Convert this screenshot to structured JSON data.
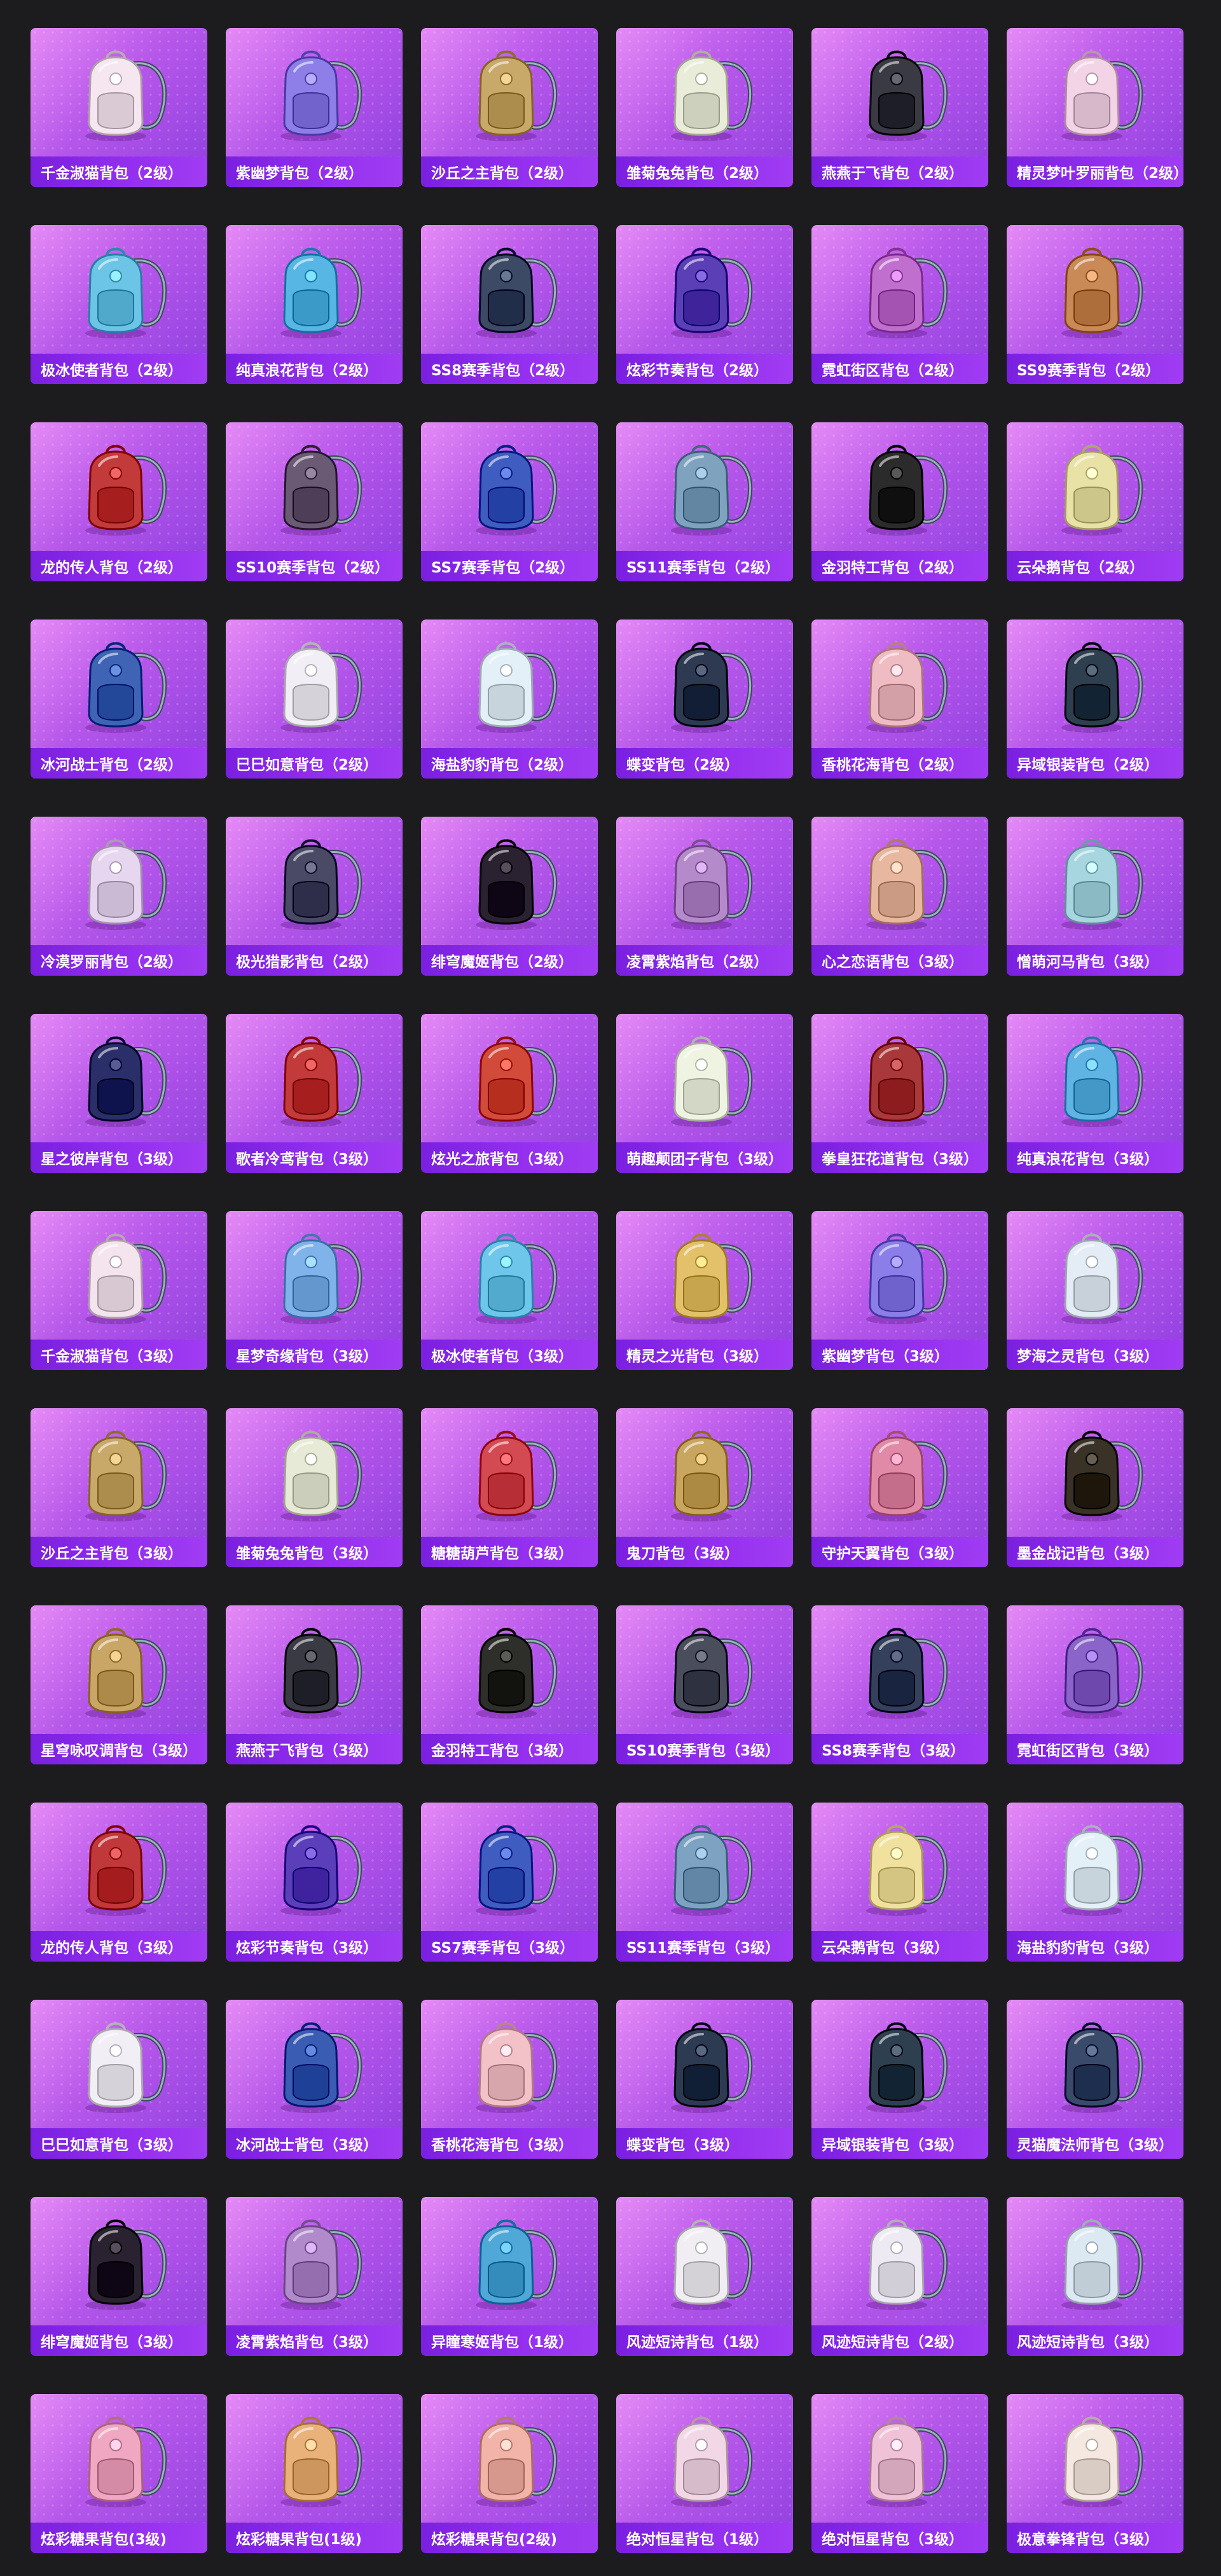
{
  "items": [
    {
      "name": "千金淑猫背包（2级）",
      "icon": "cat-backpack-icon",
      "color": "#f5e6ef"
    },
    {
      "name": "紫幽梦背包（2级）",
      "icon": "purple-bunny-backpack-icon",
      "color": "#8d7ee8"
    },
    {
      "name": "沙丘之主背包（2级）",
      "icon": "scroll-backpack-icon",
      "color": "#c9a96a"
    },
    {
      "name": "雏菊兔兔背包（2级）",
      "icon": "daisy-bunny-backpack-icon",
      "color": "#e9ecd8"
    },
    {
      "name": "燕燕于飞背包（2级）",
      "icon": "swallow-backpack-icon",
      "color": "#3a3a44"
    },
    {
      "name": "精灵梦叶罗丽背包（2级）",
      "icon": "fairy-heart-backpack-icon",
      "color": "#f3d3e6"
    },
    {
      "name": "极冰使者背包（2级）",
      "icon": "ice-crystal-backpack-icon",
      "color": "#6cc4e6"
    },
    {
      "name": "纯真浪花背包（2级）",
      "icon": "drink-cup-backpack-icon",
      "color": "#57b6e4"
    },
    {
      "name": "SS8赛季背包（2级）",
      "icon": "tactical-backpack-icon",
      "color": "#3d4a66"
    },
    {
      "name": "炫彩节奏背包（2级）",
      "icon": "rhythm-backpack-icon",
      "color": "#5a3fb6"
    },
    {
      "name": "霓虹街区背包（2级）",
      "icon": "neon-backpack-icon",
      "color": "#c06fcf"
    },
    {
      "name": "SS9赛季背包（2级）",
      "icon": "orange-backpack-icon",
      "color": "#c98a57"
    },
    {
      "name": "龙的传人背包（2级）",
      "icon": "dragon-backpack-icon",
      "color": "#c33a3a"
    },
    {
      "name": "SS10赛季背包（2级）",
      "icon": "ss10-backpack-icon",
      "color": "#6b5a73"
    },
    {
      "name": "SS7赛季背包（2级）",
      "icon": "ss7-backpack-icon",
      "color": "#3f5cc0"
    },
    {
      "name": "SS11赛季背包（2级）",
      "icon": "ss11-backpack-icon",
      "color": "#7fa3bf"
    },
    {
      "name": "金羽特工背包（2级）",
      "icon": "agent-backpack-icon",
      "color": "#2b2b2b"
    },
    {
      "name": "云朵鹅背包（2级）",
      "icon": "cloud-goose-backpack-icon",
      "color": "#e9e2a6"
    },
    {
      "name": "冰河战士背包（2级）",
      "icon": "glacier-backpack-icon",
      "color": "#3f63b5"
    },
    {
      "name": "巳巳如意背包（2级）",
      "icon": "snake-backpack-icon",
      "color": "#f1eef5"
    },
    {
      "name": "海盐豹豹背包（2级）",
      "icon": "seal-backpack-icon",
      "color": "#e3f0f7"
    },
    {
      "name": "蝶变背包（2级）",
      "icon": "butterfly-backpack-icon",
      "color": "#2d3a52"
    },
    {
      "name": "香桃花海背包（2级）",
      "icon": "peach-backpack-icon",
      "color": "#f0bcc4"
    },
    {
      "name": "异域银装背包（2级）",
      "icon": "exotic-backpack-icon",
      "color": "#2e3f4f"
    },
    {
      "name": "冷漠罗丽背包（2级）",
      "icon": "crystal-heart-backpack-icon",
      "color": "#e7d6f0"
    },
    {
      "name": "极光猎影背包（2级）",
      "icon": "aurora-backpack-icon",
      "color": "#4a4a66"
    },
    {
      "name": "绯穹魔姬背包（2级）",
      "icon": "demon-backpack-icon",
      "color": "#2a2230"
    },
    {
      "name": "凌霄紫焰背包（2级）",
      "icon": "violet-flame-backpack-icon",
      "color": "#b58acb"
    },
    {
      "name": "心之恋语背包（3级）",
      "icon": "star-backpack-icon",
      "color": "#e7b7a0"
    },
    {
      "name": "憎萌河马背包（3级）",
      "icon": "hippo-backpack-icon",
      "color": "#a8d6e0"
    },
    {
      "name": "星之彼岸背包（3级）",
      "icon": "galaxy-backpack-icon",
      "color": "#2a2f6a"
    },
    {
      "name": "歌者冷鸢背包（3级）",
      "icon": "red-pouch-backpack-icon",
      "color": "#c23a3a"
    },
    {
      "name": "炫光之旅背包（3级）",
      "icon": "dino-backpack-icon",
      "color": "#d24a3a"
    },
    {
      "name": "萌趣颠团子背包（3级）",
      "icon": "sprout-backpack-icon",
      "color": "#eef3e2"
    },
    {
      "name": "拳皇狂花道背包（3级）",
      "icon": "warrior-backpack-icon",
      "color": "#a8383a"
    },
    {
      "name": "纯真浪花背包（3级）",
      "icon": "drink-cup-backpack-icon",
      "color": "#5fb4e4"
    },
    {
      "name": "千金淑猫背包（3级）",
      "icon": "cat-backpack-icon",
      "color": "#f4e4ee"
    },
    {
      "name": "星梦奇缘背包（3级）",
      "icon": "swan-backpack-icon",
      "color": "#7fb3ea"
    },
    {
      "name": "极冰使者背包（3级）",
      "icon": "ice-crystal-backpack-icon",
      "color": "#6ec7ea"
    },
    {
      "name": "精灵之光背包（3级）",
      "icon": "golden-backpack-icon",
      "color": "#e3c06a"
    },
    {
      "name": "紫幽梦背包（3级）",
      "icon": "purple-bunny-backpack-icon",
      "color": "#8b7ee8"
    },
    {
      "name": "梦海之灵背包（3级）",
      "icon": "sea-spirit-backpack-icon",
      "color": "#e4ecf5"
    },
    {
      "name": "沙丘之主背包（3级）",
      "icon": "scroll-backpack-icon",
      "color": "#c9a96a"
    },
    {
      "name": "雏菊兔兔背包（3级）",
      "icon": "daisy-bunny-backpack-icon",
      "color": "#e6ead6"
    },
    {
      "name": "糖糖葫芦背包（3级）",
      "icon": "candy-backpack-icon",
      "color": "#d44a52"
    },
    {
      "name": "鬼刀背包（3级）",
      "icon": "ghost-blade-backpack-icon",
      "color": "#c8a660"
    },
    {
      "name": "守护天翼背包（3级）",
      "icon": "wing-backpack-icon",
      "color": "#e08aa8"
    },
    {
      "name": "墨金战记背包（3级）",
      "icon": "ink-gold-backpack-icon",
      "color": "#3a3226"
    },
    {
      "name": "星穹咏叹调背包（3级）",
      "icon": "aria-backpack-icon",
      "color": "#c9a666"
    },
    {
      "name": "燕燕于飞背包（3级）",
      "icon": "swallow-backpack-icon",
      "color": "#3a3a44"
    },
    {
      "name": "金羽特工背包（3级）",
      "icon": "agent-backpack-icon",
      "color": "#2e2e2a"
    },
    {
      "name": "SS10赛季背包（3级）",
      "icon": "ss10-backpack-icon",
      "color": "#4a4d5c"
    },
    {
      "name": "SS8赛季背包（3级）",
      "icon": "tactical-backpack-icon",
      "color": "#34405c"
    },
    {
      "name": "霓虹街区背包（3级）",
      "icon": "neon-backpack-icon",
      "color": "#8a64c8"
    },
    {
      "name": "龙的传人背包（3级）",
      "icon": "dragon-backpack-icon",
      "color": "#c0383a"
    },
    {
      "name": "炫彩节奏背包（3级）",
      "icon": "rhythm-backpack-icon",
      "color": "#5b3fba"
    },
    {
      "name": "SS7赛季背包（3级）",
      "icon": "ss7-backpack-icon",
      "color": "#3f5cc0"
    },
    {
      "name": "SS11赛季背包（3级）",
      "icon": "ss11-backpack-icon",
      "color": "#7da2c2"
    },
    {
      "name": "云朵鹅背包（3级）",
      "icon": "cloud-goose-backpack-icon",
      "color": "#f0e29e"
    },
    {
      "name": "海盐豹豹背包（3级）",
      "icon": "seal-backpack-icon",
      "color": "#e3f0f7"
    },
    {
      "name": "巳巳如意背包（3级）",
      "icon": "snake-backpack-icon",
      "color": "#f2eef6"
    },
    {
      "name": "冰河战士背包（3级）",
      "icon": "glacier-backpack-icon",
      "color": "#3a5cb2"
    },
    {
      "name": "香桃花海背包（3级）",
      "icon": "peach-backpack-icon",
      "color": "#f2c2c8"
    },
    {
      "name": "蝶变背包（3级）",
      "icon": "butterfly-backpack-icon",
      "color": "#2c3a52"
    },
    {
      "name": "异域银装背包（3级）",
      "icon": "exotic-backpack-icon",
      "color": "#2e4050"
    },
    {
      "name": "灵猫魔法师背包（3级）",
      "icon": "magic-cat-backpack-icon",
      "color": "#3a4a6a"
    },
    {
      "name": "绯穹魔姬背包（3级）",
      "icon": "demon-backpack-icon",
      "color": "#2a2230"
    },
    {
      "name": "凌霄紫焰背包（3级）",
      "icon": "violet-flame-backpack-icon",
      "color": "#b08acb"
    },
    {
      "name": "异瞳寒姬背包（1级）",
      "icon": "frost-backpack-icon",
      "color": "#4fa8d8"
    },
    {
      "name": "风迹短诗背包（1级）",
      "icon": "poem-backpack-icon",
      "color": "#f0eef2"
    },
    {
      "name": "风迹短诗背包（2级）",
      "icon": "poem-backpack-icon",
      "color": "#eeeaf4"
    },
    {
      "name": "风迹短诗背包（3级）",
      "icon": "poem-backpack-icon",
      "color": "#dce8f2"
    },
    {
      "name": "炫彩糖果背包(3级)",
      "icon": "donut-backpack-icon",
      "color": "#f0a8c2"
    },
    {
      "name": "炫彩糖果背包(1级)",
      "icon": "donut-backpack-icon",
      "color": "#e8b27a"
    },
    {
      "name": "炫彩糖果背包(2级)",
      "icon": "donut-backpack-icon",
      "color": "#f2b4a8"
    },
    {
      "name": "绝对恒星背包（1级）",
      "icon": "milk-tea-backpack-icon",
      "color": "#f2d8e6"
    },
    {
      "name": "绝对恒星背包（3级）",
      "icon": "popcorn-backpack-icon",
      "color": "#f0c2d8"
    },
    {
      "name": "极意拳锋背包（3级）",
      "icon": "fist-backpack-icon",
      "color": "#f4e8e0"
    }
  ]
}
